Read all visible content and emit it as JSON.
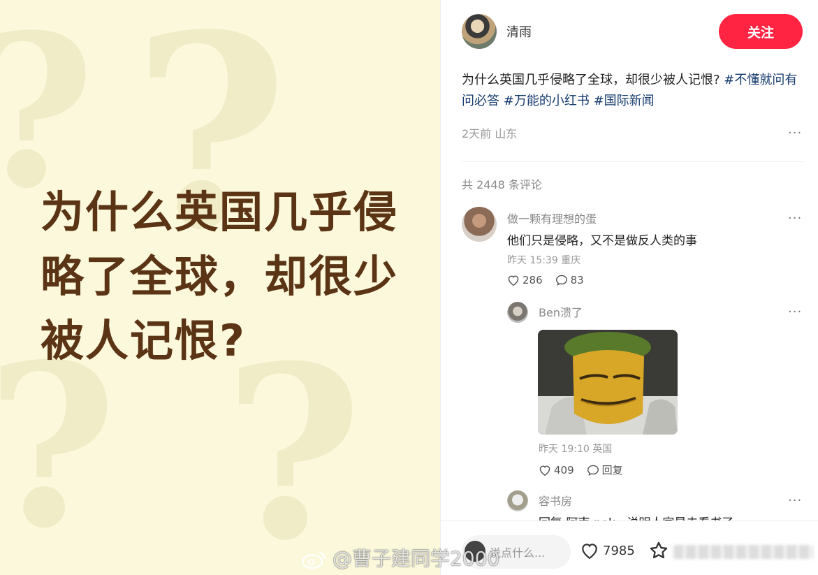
{
  "cover": {
    "title": "为什么英国几乎侵略了全球，却很少被人记恨?"
  },
  "author": {
    "name": "清雨",
    "follow_label": "关注"
  },
  "post": {
    "text": "为什么英国几乎侵略了全球，却很少被人记恨? ",
    "tags": [
      "#不懂就问有问必答",
      "#万能的小红书",
      "#国际新闻"
    ],
    "meta": "2天前 山东"
  },
  "comments_header": "共 2448 条评论",
  "comments": [
    {
      "user": "做一颗有理想的蛋",
      "text": "他们只是侵略，又不是做反人类的事",
      "meta": "昨天 15:39 重庆",
      "likes": "286",
      "replies": "83"
    },
    {
      "user": "Ben溃了",
      "meta": "昨天 19:10 英国",
      "likes": "409",
      "reply_label": "回复"
    },
    {
      "user": "容书房",
      "text": "回复 阿南 nok : 说明人家是去看书了"
    }
  ],
  "bottom": {
    "input_placeholder": "说点什么...",
    "likes": "7985"
  },
  "watermark": "@曹子建同学2000",
  "colors": {
    "accent": "#ff2442",
    "tag": "#13386c",
    "cover_bg": "#fbf8dc",
    "cover_text": "#5a3415"
  }
}
